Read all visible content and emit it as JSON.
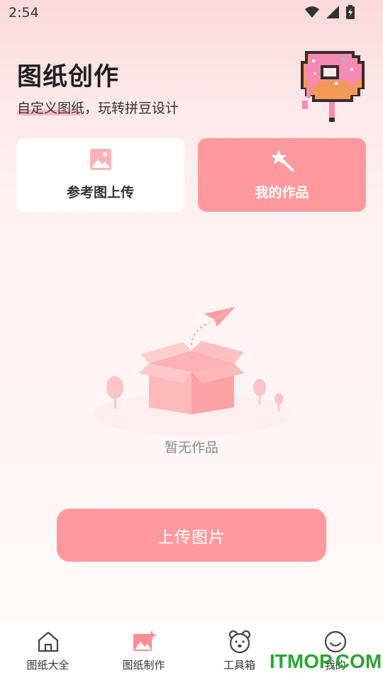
{
  "status": {
    "time": "2:54"
  },
  "header": {
    "title": "图纸创作",
    "subtitle": "自定义图纸，玩转拼豆设计"
  },
  "cards": {
    "reference_upload": "参考图上传",
    "my_works": "我的作品"
  },
  "empty_state": {
    "text": "暂无作品"
  },
  "upload_button": {
    "label": "上传图片"
  },
  "tabs": [
    {
      "label": "图纸大全",
      "icon": "home-icon",
      "active": false
    },
    {
      "label": "图纸制作",
      "icon": "image-sparkle-icon",
      "active": true
    },
    {
      "label": "工具箱",
      "icon": "bear-icon",
      "active": false
    },
    {
      "label": "我的",
      "icon": "smile-icon",
      "active": false
    }
  ],
  "watermark": "ITMOP.COM",
  "colors": {
    "accent": "#fe9a9d",
    "background": "#fff6f7",
    "watermark": "#2ea437"
  }
}
